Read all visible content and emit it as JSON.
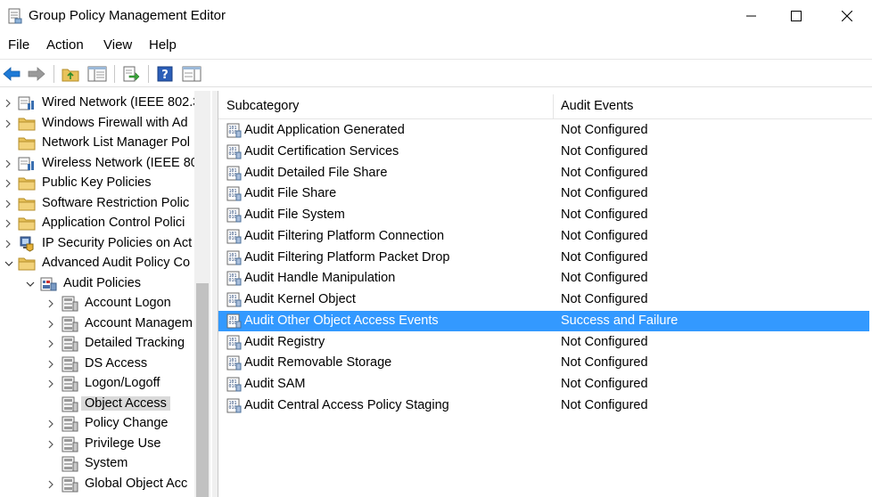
{
  "window": {
    "title": "Group Policy Management Editor"
  },
  "menu": [
    "File",
    "Action",
    "View",
    "Help"
  ],
  "toolbar": {
    "buttons": [
      "back-arrow-icon",
      "forward-arrow-icon",
      "up-folder-icon",
      "show-hide-tree-icon",
      "export-list-icon",
      "help-icon",
      "properties-pane-icon"
    ]
  },
  "tree": {
    "items": [
      {
        "label": "Wired Network (IEEE 802.3",
        "expand": "collapsed",
        "icon": "network-icon"
      },
      {
        "label": "Windows Firewall with Ad",
        "expand": "collapsed",
        "icon": "folder-icon"
      },
      {
        "label": "Network List Manager Pol",
        "expand": "none",
        "icon": "folder-icon"
      },
      {
        "label": "Wireless Network (IEEE 80",
        "expand": "collapsed",
        "icon": "network-icon"
      },
      {
        "label": "Public Key Policies",
        "expand": "collapsed",
        "icon": "folder-icon"
      },
      {
        "label": "Software Restriction Polic",
        "expand": "collapsed",
        "icon": "folder-icon"
      },
      {
        "label": "Application Control Polici",
        "expand": "collapsed",
        "icon": "folder-icon"
      },
      {
        "label": "IP Security Policies on Act",
        "expand": "collapsed",
        "icon": "ip-security-icon"
      },
      {
        "label": "Advanced Audit Policy Co",
        "expand": "expanded",
        "icon": "folder-icon"
      },
      {
        "label": "Audit Policies",
        "expand": "expanded",
        "icon": "audit-policies-icon"
      },
      {
        "label": "Account Logon",
        "expand": "collapsed",
        "icon": "policy-icon"
      },
      {
        "label": "Account Managem",
        "expand": "collapsed",
        "icon": "policy-icon"
      },
      {
        "label": "Detailed Tracking",
        "expand": "collapsed",
        "icon": "policy-icon"
      },
      {
        "label": "DS Access",
        "expand": "collapsed",
        "icon": "policy-icon"
      },
      {
        "label": "Logon/Logoff",
        "expand": "collapsed",
        "icon": "policy-icon"
      },
      {
        "label": "Object Access",
        "expand": "none",
        "icon": "policy-icon",
        "selected": true
      },
      {
        "label": "Policy Change",
        "expand": "collapsed",
        "icon": "policy-icon"
      },
      {
        "label": "Privilege Use",
        "expand": "collapsed",
        "icon": "policy-icon"
      },
      {
        "label": "System",
        "expand": "none",
        "icon": "policy-icon"
      },
      {
        "label": "Global Object Acc",
        "expand": "collapsed",
        "icon": "policy-icon"
      }
    ]
  },
  "list": {
    "columns": [
      "Subcategory",
      "Audit Events"
    ],
    "rows": [
      {
        "subcategory": "Audit Application Generated",
        "events": "Not Configured"
      },
      {
        "subcategory": "Audit Certification Services",
        "events": "Not Configured"
      },
      {
        "subcategory": "Audit Detailed File Share",
        "events": "Not Configured"
      },
      {
        "subcategory": "Audit File Share",
        "events": "Not Configured"
      },
      {
        "subcategory": "Audit File System",
        "events": "Not Configured"
      },
      {
        "subcategory": "Audit Filtering Platform Connection",
        "events": "Not Configured"
      },
      {
        "subcategory": "Audit Filtering Platform Packet Drop",
        "events": "Not Configured"
      },
      {
        "subcategory": "Audit Handle Manipulation",
        "events": "Not Configured"
      },
      {
        "subcategory": "Audit Kernel Object",
        "events": "Not Configured"
      },
      {
        "subcategory": "Audit Other Object Access Events",
        "events": "Success and Failure",
        "selected": true
      },
      {
        "subcategory": "Audit Registry",
        "events": "Not Configured"
      },
      {
        "subcategory": "Audit Removable Storage",
        "events": "Not Configured"
      },
      {
        "subcategory": "Audit SAM",
        "events": "Not Configured"
      },
      {
        "subcategory": "Audit Central Access Policy Staging",
        "events": "Not Configured"
      }
    ]
  },
  "colors": {
    "selection": "#3399ff",
    "tree_selection": "#d9d9d9",
    "arrow_blue": "#1e7ad6",
    "folder_yellow": "#e8c25a"
  }
}
